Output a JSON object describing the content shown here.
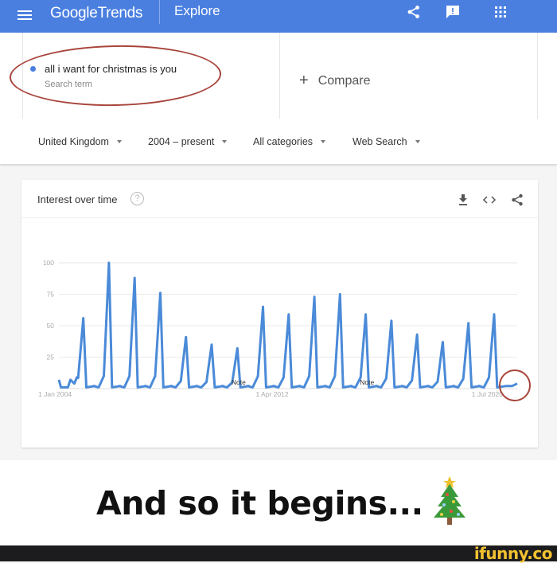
{
  "topbar": {
    "app_name_part1": "Google",
    "app_name_part2": "Trends",
    "section": "Explore",
    "icons": [
      "menu-icon",
      "share-icon",
      "feedback-icon",
      "apps-grid-icon"
    ],
    "color": "#4a7fe0"
  },
  "search": {
    "term": "all i want for christmas is you",
    "term_sub": "Search term",
    "term_color": "#4a7fe0",
    "compare_label": "Compare",
    "annotation_color": "#a8453c"
  },
  "filters": [
    {
      "label": "United Kingdom"
    },
    {
      "label": "2004 – present"
    },
    {
      "label": "All categories"
    },
    {
      "label": "Web Search"
    }
  ],
  "card": {
    "title": "Interest over time",
    "help": "?",
    "icons": [
      "download-icon",
      "embed-icon",
      "share-icon"
    ]
  },
  "chart_data": {
    "type": "line",
    "title": "Interest over time",
    "xlabel": "",
    "ylabel": "",
    "ylim": [
      0,
      100
    ],
    "yticks": [
      25,
      50,
      75,
      100
    ],
    "xtick_labels": [
      "1 Jan 2004",
      "1 Apr 2012",
      "1 Jul 2020"
    ],
    "grid": true,
    "series_color": "#4a8ad8",
    "notes": [
      {
        "label": "Note",
        "year": 2011.0
      },
      {
        "label": "Note",
        "year": 2016.0
      }
    ],
    "series": [
      {
        "name": "all i want for christmas is you",
        "x_start": 2004.0,
        "x_end": 2021.85,
        "peaks": [
          {
            "year": 2004.95,
            "value": 56
          },
          {
            "year": 2005.95,
            "value": 100
          },
          {
            "year": 2006.95,
            "value": 88
          },
          {
            "year": 2007.95,
            "value": 76
          },
          {
            "year": 2008.95,
            "value": 41
          },
          {
            "year": 2009.95,
            "value": 35
          },
          {
            "year": 2010.95,
            "value": 32
          },
          {
            "year": 2011.95,
            "value": 65
          },
          {
            "year": 2012.95,
            "value": 59
          },
          {
            "year": 2013.95,
            "value": 73
          },
          {
            "year": 2014.95,
            "value": 75
          },
          {
            "year": 2015.95,
            "value": 59
          },
          {
            "year": 2016.95,
            "value": 54
          },
          {
            "year": 2017.95,
            "value": 43
          },
          {
            "year": 2018.95,
            "value": 37
          },
          {
            "year": 2019.95,
            "value": 52
          },
          {
            "year": 2020.95,
            "value": 59
          }
        ],
        "baseline": 1,
        "end_value": 4
      }
    ],
    "highlight_circle_at": "end of series"
  },
  "caption": {
    "text": "And so it begins...",
    "emoji": "christmas-tree"
  },
  "watermark": "ifunny.co"
}
